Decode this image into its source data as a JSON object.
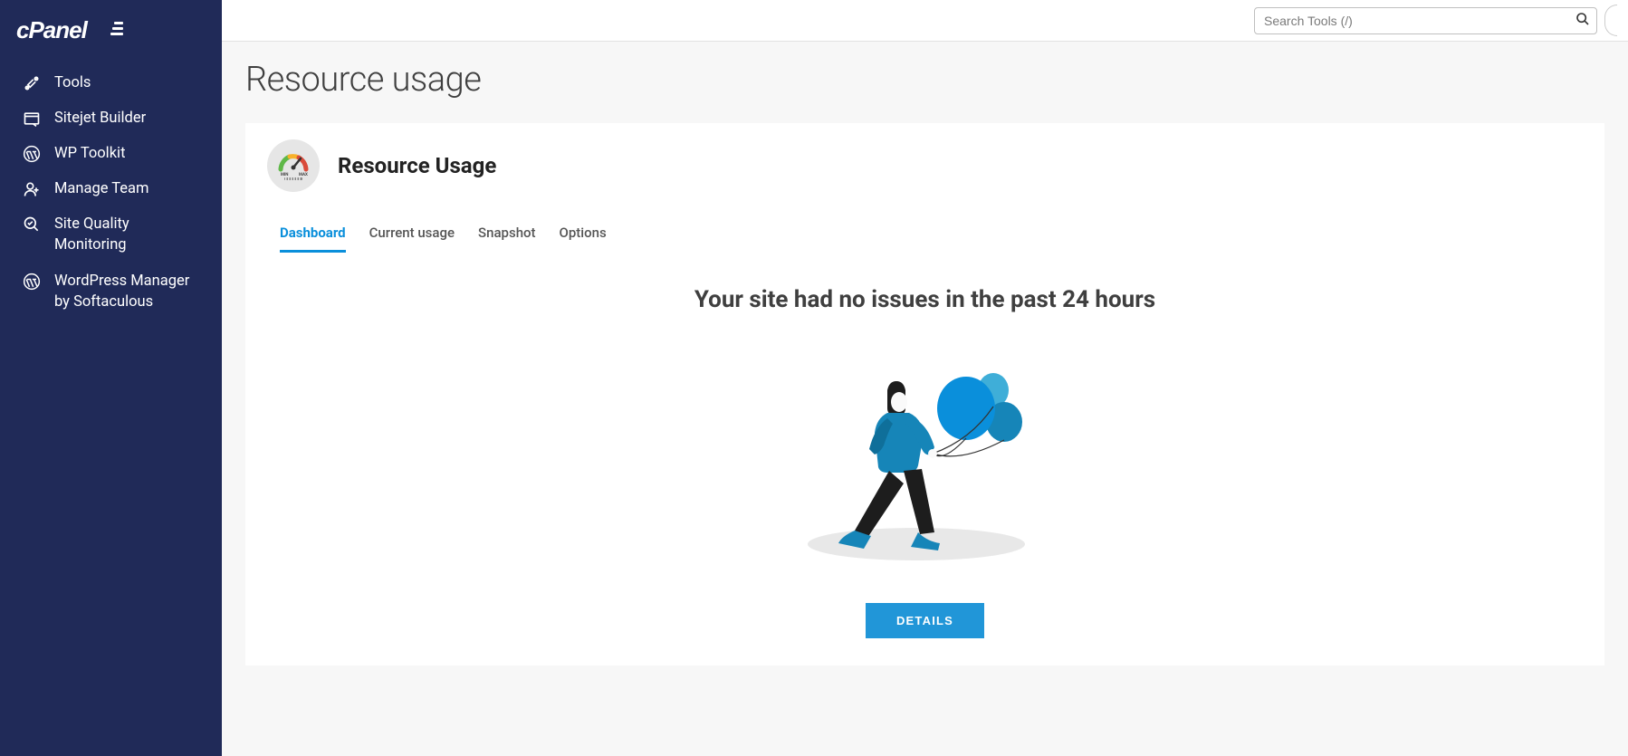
{
  "search": {
    "placeholder": "Search Tools (/)"
  },
  "sidebar": {
    "items": [
      {
        "label": "Tools"
      },
      {
        "label": "Sitejet Builder"
      },
      {
        "label": "WP Toolkit"
      },
      {
        "label": "Manage Team"
      },
      {
        "label": "Site Quality Monitoring"
      },
      {
        "label": "WordPress Manager by Softaculous"
      }
    ]
  },
  "page": {
    "title": "Resource usage"
  },
  "panel": {
    "title": "Resource Usage",
    "gauge_min": "MIN",
    "gauge_max": "MAX"
  },
  "tabs": [
    {
      "label": "Dashboard",
      "active": true
    },
    {
      "label": "Current usage",
      "active": false
    },
    {
      "label": "Snapshot",
      "active": false
    },
    {
      "label": "Options",
      "active": false
    }
  ],
  "dashboard": {
    "status_heading": "Your site had no issues in the past 24 hours",
    "details_button": "DETAILS"
  },
  "colors": {
    "sidebar_bg": "#202a58",
    "accent": "#0a8fdb",
    "button": "#2196d8"
  }
}
